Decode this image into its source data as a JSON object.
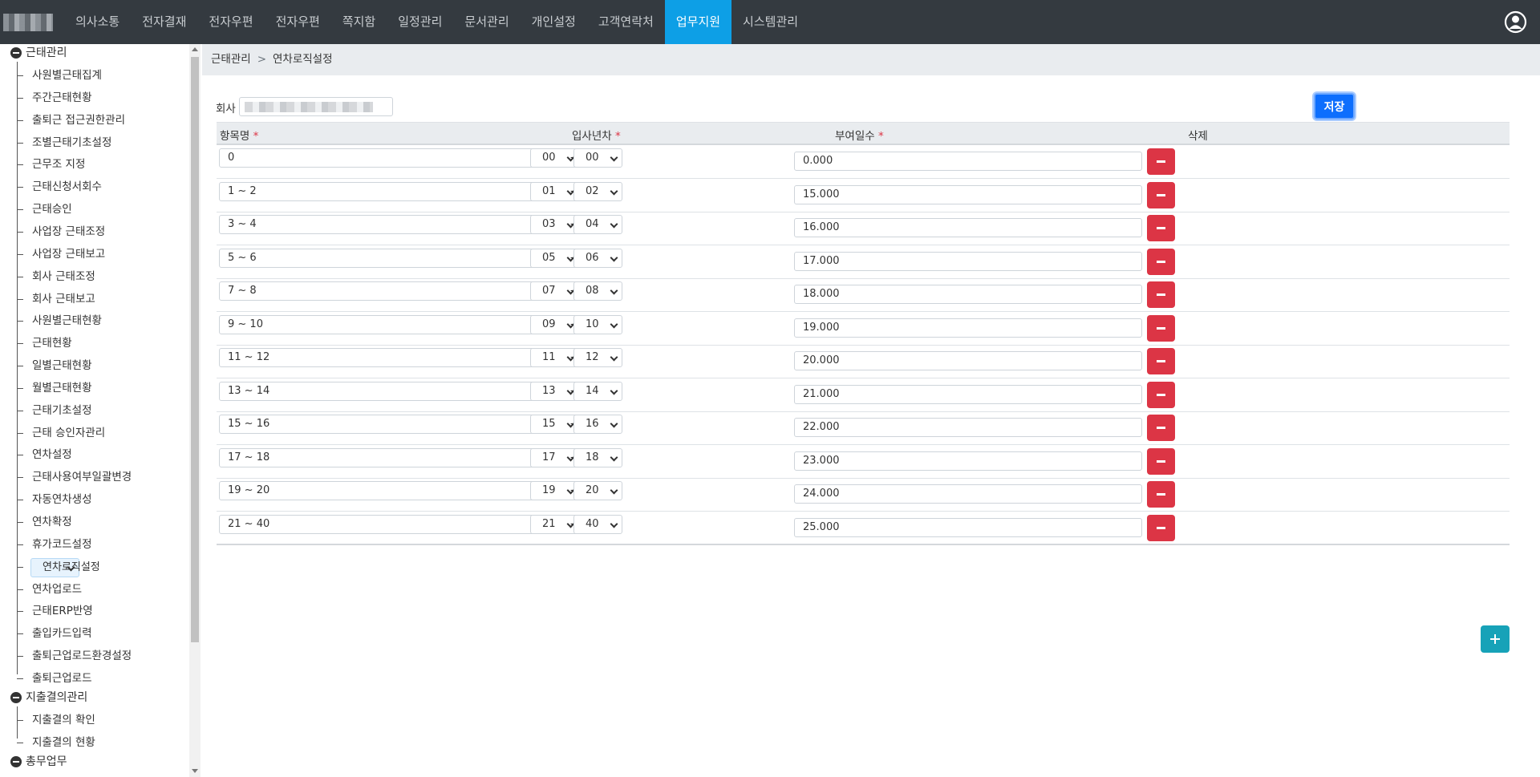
{
  "topnav": {
    "items": [
      "의사소통",
      "전자결재",
      "전자우편",
      "전자우편",
      "쪽지함",
      "일정관리",
      "문서관리",
      "개인설정",
      "고객연락처",
      "업무지원",
      "시스템관리"
    ],
    "active_index": 9,
    "user_icon": "user-circle-icon"
  },
  "sidebar": {
    "group1": "근태관리",
    "items": [
      "사원별근태집계",
      "주간근태현황",
      "출퇴근 접근권한관리",
      "조별근태기초설정",
      "근무조 지정",
      "근태신청서회수",
      "근태승인",
      "사업장 근태조정",
      "사업장 근태보고",
      "회사 근태조정",
      "회사 근태보고",
      "사원별근태현황",
      "근태현황",
      "일별근태현황",
      "월별근태현황",
      "근태기초설정",
      "근태 승인자관리",
      "연차설정",
      "근태사용여부일괄변경",
      "자동연차생성",
      "연차확정",
      "휴가코드설정",
      "연차로직설정",
      "연차업로드",
      "근태ERP반영",
      "출입카드입력",
      "출퇴근업로드환경설정",
      "출퇴근업로드"
    ],
    "selected_index": 22,
    "group2": "지출결의관리",
    "group2_items": [
      "지출결의 확인",
      "지출결의 현황"
    ],
    "group3": "총무업무"
  },
  "breadcrumb": {
    "parent": "근태관리",
    "sep": ">",
    "current": "연차로직설정"
  },
  "form": {
    "company_label": "회사",
    "save_label": "저장"
  },
  "table": {
    "headers": {
      "name": "항목명",
      "years": "입사년차",
      "days": "부여일수",
      "delete": "삭제"
    },
    "required_mark": "*",
    "rows": [
      {
        "name": "0",
        "from": "00",
        "to": "00",
        "days": "0.000"
      },
      {
        "name": "1 ~ 2",
        "from": "01",
        "to": "02",
        "days": "15.000"
      },
      {
        "name": "3 ~ 4",
        "from": "03",
        "to": "04",
        "days": "16.000"
      },
      {
        "name": "5 ~ 6",
        "from": "05",
        "to": "06",
        "days": "17.000"
      },
      {
        "name": "7 ~ 8",
        "from": "07",
        "to": "08",
        "days": "18.000"
      },
      {
        "name": "9 ~ 10",
        "from": "09",
        "to": "10",
        "days": "19.000"
      },
      {
        "name": "11 ~ 12",
        "from": "11",
        "to": "12",
        "days": "20.000"
      },
      {
        "name": "13 ~ 14",
        "from": "13",
        "to": "14",
        "days": "21.000"
      },
      {
        "name": "15 ~ 16",
        "from": "15",
        "to": "16",
        "days": "22.000"
      },
      {
        "name": "17 ~ 18",
        "from": "17",
        "to": "18",
        "days": "23.000"
      },
      {
        "name": "19 ~ 20",
        "from": "19",
        "to": "20",
        "days": "24.000"
      },
      {
        "name": "21 ~ 40",
        "from": "21",
        "to": "40",
        "days": "25.000"
      }
    ]
  },
  "colors": {
    "nav_bg": "#343a40",
    "nav_active": "#0d9fe6",
    "save": "#0d6efd",
    "delete": "#dc3545",
    "add": "#17a2b8"
  }
}
